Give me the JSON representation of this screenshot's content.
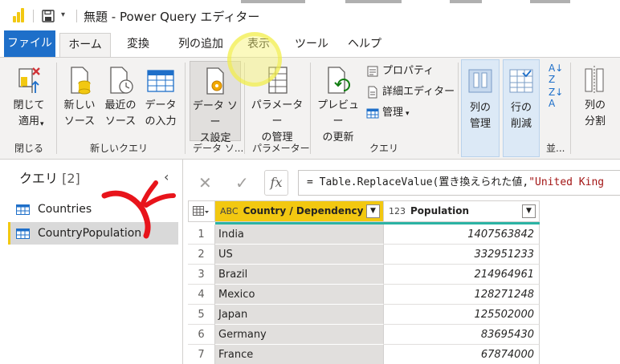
{
  "window": {
    "title": "無題 - Power Query エディター"
  },
  "tabs": [
    {
      "label": "ファイル"
    },
    {
      "label": "ホーム"
    },
    {
      "label": "変換"
    },
    {
      "label": "列の追加"
    },
    {
      "label": "表示"
    },
    {
      "label": "ツール"
    },
    {
      "label": "ヘルプ"
    }
  ],
  "ribbon": {
    "close_apply": {
      "label": "閉じて\n適用"
    },
    "new_source": {
      "label": "新しい\nソース"
    },
    "recent_sources": {
      "label": "最近の\nソース"
    },
    "enter_data": {
      "label": "データ\nの入力"
    },
    "data_source_settings": {
      "label": "データ ソー\nス設定"
    },
    "manage_parameters": {
      "label": "パラメーター\nの管理"
    },
    "refresh_preview": {
      "label": "プレビュー\nの更新"
    },
    "properties": {
      "label": "プロパティ"
    },
    "advanced_editor": {
      "label": "詳細エディター"
    },
    "manage": {
      "label": "管理"
    },
    "choose_columns": {
      "label": "列の\n管理"
    },
    "reduce_rows": {
      "label": "行の\n削減"
    },
    "split_column": {
      "label": "列の\n分割"
    },
    "groups": {
      "close": "閉じる",
      "new_query": "新しいクエリ",
      "data_sources": "データ ソ...",
      "parameters": "パラメーター",
      "query": "クエリ",
      "sort": "並..."
    }
  },
  "queries_pane": {
    "title": "クエリ",
    "count": "[2]",
    "items": [
      {
        "label": "Countries"
      },
      {
        "label": "CountryPopulation"
      }
    ]
  },
  "formula_bar": {
    "prefix": "= Table.ReplaceValue(置き換えられた値,",
    "string_part": "\"United King"
  },
  "grid": {
    "columns": [
      {
        "type_icon": "ABC",
        "name": "Country / Dependency"
      },
      {
        "type_icon": "123",
        "name": "Population"
      }
    ],
    "rows": [
      {
        "n": "1",
        "country": "India",
        "population": "1407563842"
      },
      {
        "n": "2",
        "country": "US",
        "population": "332951233"
      },
      {
        "n": "3",
        "country": "Brazil",
        "population": "214964961"
      },
      {
        "n": "4",
        "country": "Mexico",
        "population": "128271248"
      },
      {
        "n": "5",
        "country": "Japan",
        "population": "125502000"
      },
      {
        "n": "6",
        "country": "Germany",
        "population": "83695430"
      },
      {
        "n": "7",
        "country": "France",
        "population": "67874000"
      }
    ]
  },
  "colors": {
    "file_tab": "#1e6fc9",
    "accent_yellow": "#f2c811",
    "quality_bar": "#2bb3a4",
    "annotation_red": "#e8141b"
  }
}
